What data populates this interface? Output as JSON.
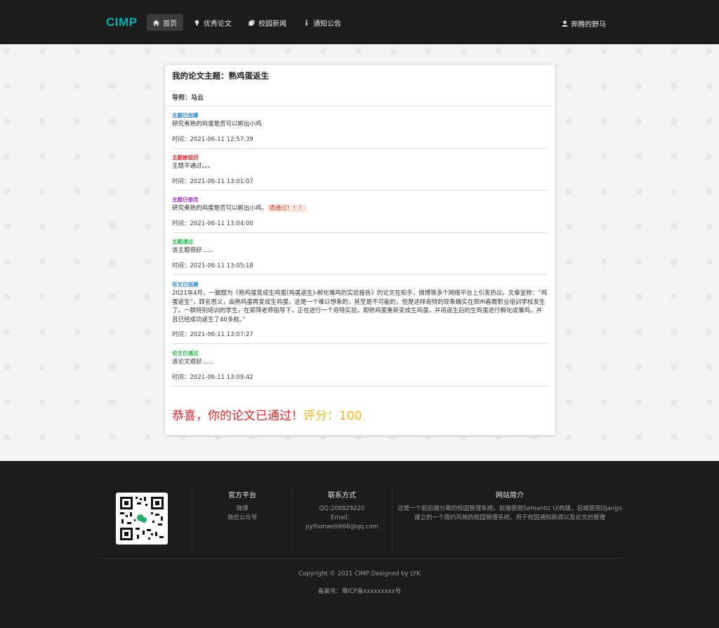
{
  "header": {
    "logo": "CIMP",
    "nav": [
      {
        "label": "首页",
        "icon": "home-icon",
        "active": true
      },
      {
        "label": "优秀论文",
        "icon": "lightbulb-icon",
        "active": false
      },
      {
        "label": "校园新闻",
        "icon": "clone-icon",
        "active": false
      },
      {
        "label": "通知公告",
        "icon": "info-icon",
        "active": false
      }
    ],
    "user": "奔腾的野马"
  },
  "card": {
    "title": "我的论文主题：熟鸡蛋返生",
    "advisor": "导师：马云",
    "events": [
      {
        "tag": "主题已创建",
        "color": "#2185d0",
        "body": "研究煮熟的鸡蛋是否可以孵出小鸡",
        "time": "时间：2021-06-11 12:57:39"
      },
      {
        "tag": "主题被驳回",
        "color": "#db2828",
        "body": "主题不通过。。。",
        "time": "时间：2021-06-11 13:01:07"
      },
      {
        "tag": "主题已修改",
        "color": "#a333c8",
        "body": "研究煮熟的鸡蛋是否可以孵出小鸡，",
        "highlight": "请通过！！！",
        "time": "时间：2021-06-11 13:04:00"
      },
      {
        "tag": "主题通过",
        "color": "#21ba45",
        "body": "该主题很好......",
        "time": "时间：2021-06-11 13:05:18"
      },
      {
        "tag": "论文已创建",
        "color": "#2185d0",
        "body": "2021年4月，一篇题为《熟鸡蛋变成生鸡蛋(鸡蛋返生)-孵化雏鸡的实验报告》的论文在知乎、微博等多个网络平台上引发热议。文章宣称：“鸡蛋返生”，顾名思义，由熟鸡蛋再变成生鸡蛋。这是一个难以想象的，甚至是不可能的，但是这样奇特的现象确实在郑州春霞职业培训学校发生了。一群特别培训的学生，在郭萍老师指导下，正在进行一个奇特实验，即熟鸡蛋重新变成生鸡蛋，并将返生后的生鸡蛋进行孵化成雏鸡，并且已经成功返生了40多枚。”",
        "time": "时间：2021-06-11 13:07:27"
      },
      {
        "tag": "论文已通过",
        "color": "#21ba45",
        "body": "该论文很好......",
        "time": "时间：2021-06-11 13:09:42"
      }
    ],
    "result_text": "恭喜，你的论文已通过！",
    "score_label": "评分：",
    "score": "100"
  },
  "footer": {
    "platform": {
      "title": "官方平台",
      "items": [
        "微博",
        "微信公众号"
      ]
    },
    "contact": {
      "title": "联系方式",
      "qq": "QQ:208829220",
      "email_label": "Email：",
      "email": "pythonweb666@qq.com"
    },
    "about": {
      "title": "网站简介",
      "text": "这是一个前后端分离的校园管理系统，前端使用Semantic UI构建，后端使用Django建立的一个简约风格的校园管理系统，用于校园通知新闻以及论文的管理"
    },
    "copyright": "Copyright © 2021 CIMP Designed by LYK",
    "icp": "备案号：豫ICP备xxxxxxxxx号"
  },
  "colors": {
    "accent": "#00b5ad",
    "dark": "#1c1c1c",
    "red": "#db2828",
    "yellow": "#f2b51e"
  }
}
